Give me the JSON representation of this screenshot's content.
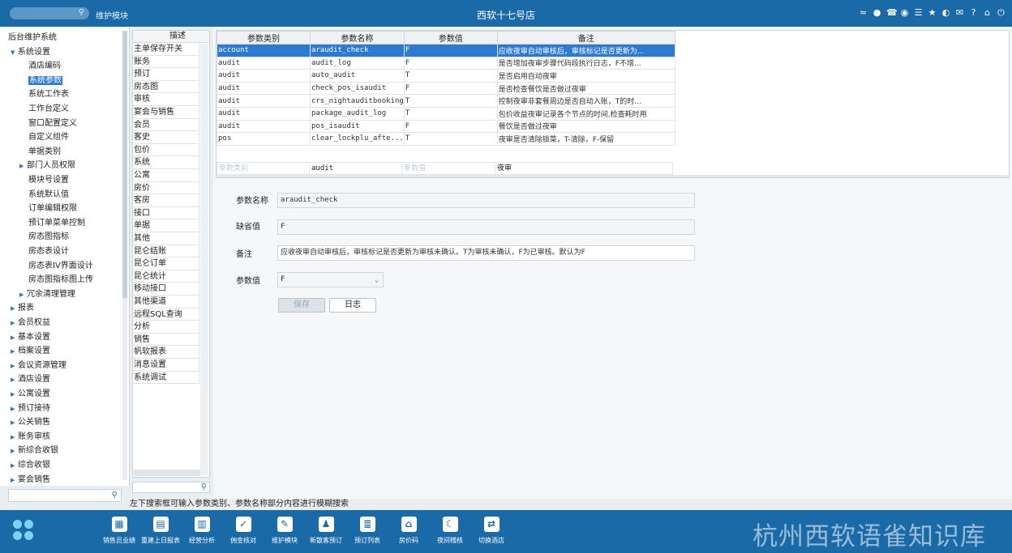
{
  "topbar": {
    "module": "维护模块",
    "title": "西软十七号店",
    "icons": [
      "wifi-icon",
      "chat-icon",
      "phone-icon",
      "palette-icon",
      "menu-icon",
      "star-icon",
      "theme-icon",
      "mail-icon",
      "help-icon",
      "home-icon",
      "power-icon"
    ]
  },
  "tree": {
    "items": [
      {
        "label": "后台维护系统",
        "level": 0,
        "arrow": ""
      },
      {
        "label": "系统设置",
        "level": 1,
        "arrow": "▼"
      },
      {
        "label": "酒店编码",
        "level": 2,
        "arrow": ""
      },
      {
        "label": "系统参数",
        "level": 2,
        "arrow": "",
        "selected": true
      },
      {
        "label": "系统工作表",
        "level": 2,
        "arrow": ""
      },
      {
        "label": "工作台定义",
        "level": 2,
        "arrow": ""
      },
      {
        "label": "窗口配置定义",
        "level": 2,
        "arrow": ""
      },
      {
        "label": "自定义组件",
        "level": 2,
        "arrow": ""
      },
      {
        "label": "单据类别",
        "level": 2,
        "arrow": ""
      },
      {
        "label": "部门人员权限",
        "level": 2,
        "arrow": "▶"
      },
      {
        "label": "模块号设置",
        "level": 2,
        "arrow": ""
      },
      {
        "label": "系统默认值",
        "level": 2,
        "arrow": ""
      },
      {
        "label": "订单编辑权限",
        "level": 2,
        "arrow": ""
      },
      {
        "label": "预订单菜单控制",
        "level": 2,
        "arrow": ""
      },
      {
        "label": "房态图指标",
        "level": 2,
        "arrow": ""
      },
      {
        "label": "房态表设计",
        "level": 2,
        "arrow": ""
      },
      {
        "label": "房态表IV界面设计",
        "level": 2,
        "arrow": ""
      },
      {
        "label": "房态图指标图上传",
        "level": 2,
        "arrow": ""
      },
      {
        "label": "冗余清理管理",
        "level": 2,
        "arrow": "▶"
      },
      {
        "label": "报表",
        "level": 1,
        "arrow": "▶"
      },
      {
        "label": "会员权益",
        "level": 1,
        "arrow": "▶"
      },
      {
        "label": "基本设置",
        "level": 1,
        "arrow": "▶"
      },
      {
        "label": "档案设置",
        "level": 1,
        "arrow": "▶"
      },
      {
        "label": "会议资源管理",
        "level": 1,
        "arrow": "▶"
      },
      {
        "label": "酒店设置",
        "level": 1,
        "arrow": "▶"
      },
      {
        "label": "公寓设置",
        "level": 1,
        "arrow": "▶"
      },
      {
        "label": "预订接待",
        "level": 1,
        "arrow": "▶"
      },
      {
        "label": "公关销售",
        "level": 1,
        "arrow": "▶"
      },
      {
        "label": "账务审核",
        "level": 1,
        "arrow": "▶"
      },
      {
        "label": "新综合收银",
        "level": 1,
        "arrow": "▶"
      },
      {
        "label": "综合收银",
        "level": 1,
        "arrow": "▶"
      },
      {
        "label": "宴会销售",
        "level": 1,
        "arrow": "▶"
      }
    ]
  },
  "categories": {
    "header": "描述",
    "items": [
      "主单保存开关",
      "账务",
      "预订",
      "房态图",
      "审核",
      "宴会与销售",
      "会员",
      "客史",
      "包价",
      "系统",
      "公寓",
      "房价",
      "客房",
      "接口",
      "单据",
      "其他",
      "昆仑结账",
      "昆仑订单",
      "昆仑统计",
      "移动接口",
      "其他渠道",
      "远程SQL查询",
      "分析",
      "销售",
      "帆软报表",
      "消息设置",
      "系统调试"
    ]
  },
  "grid": {
    "columns": [
      "参数类别",
      "参数名称",
      "参数值",
      "备注"
    ],
    "rows": [
      [
        "account",
        "araudit_check",
        "F",
        "应收夜审自动审核后，审核标记是否更新为..."
      ],
      [
        "audit",
        "audit_log",
        "F",
        "是否增加夜审步骤代码段执行日志，F不增..."
      ],
      [
        "audit",
        "auto_audit",
        "T",
        "是否启用自动夜审"
      ],
      [
        "audit",
        "check_pos_isaudit",
        "F",
        "是否检查餐饮是否做过夜审"
      ],
      [
        "audit",
        "crs_nightauditbooking",
        "T",
        "控制夜审非套餐周边是否自动入账，T的时..."
      ],
      [
        "audit",
        "package_audit_log",
        "T",
        "包价收益夜审记录各个节点的时间,检查耗时用"
      ],
      [
        "audit",
        "pos_isaudit",
        "F",
        "餐饮是否做过夜审"
      ],
      [
        "pos",
        "clear_lockplu_afte...",
        "T",
        "夜审是否清除锁菜，T-清除，F-保留"
      ]
    ],
    "filter": {
      "cat_placeholder": "参数类别",
      "name_value": "audit",
      "value_placeholder": "参数值",
      "remark_value": "夜审"
    }
  },
  "form": {
    "name_label": "参数名称",
    "name_value": "araudit_check",
    "default_label": "缺省值",
    "default_value": "F",
    "remark_label": "备注",
    "remark_value": "应收夜审自动审核后，审核标记是否更新为审核未确认。T为审核未确认，F为已审核。默认为F",
    "value_label": "参数值",
    "value_selected": "F",
    "save_label": "保存",
    "log_label": "日志"
  },
  "status": {
    "text": "左下搜索框可输入参数类别、参数名称部分内容进行模糊搜索"
  },
  "dock": {
    "items": [
      {
        "label": "销售员业绩",
        "icon": "chart-icon",
        "glyph": "▦"
      },
      {
        "label": "重建上日报表",
        "icon": "document-icon",
        "glyph": "▤"
      },
      {
        "label": "经营分析",
        "icon": "bar-chart-icon",
        "glyph": "▥"
      },
      {
        "label": "佣金核对",
        "icon": "check-icon",
        "glyph": "✓"
      },
      {
        "label": "维护模块",
        "icon": "wrench-icon",
        "glyph": "✎"
      },
      {
        "label": "新散客预订",
        "icon": "person-add-icon",
        "glyph": "♟"
      },
      {
        "label": "预订列表",
        "icon": "list-icon",
        "glyph": "≣"
      },
      {
        "label": "房价码",
        "icon": "house-icon",
        "glyph": "⌂"
      },
      {
        "label": "夜间稽核",
        "icon": "moon-icon",
        "glyph": "☾"
      },
      {
        "label": "切换酒店",
        "icon": "switch-icon",
        "glyph": "⇄"
      }
    ],
    "watermark": "杭州西软语雀知识库"
  }
}
